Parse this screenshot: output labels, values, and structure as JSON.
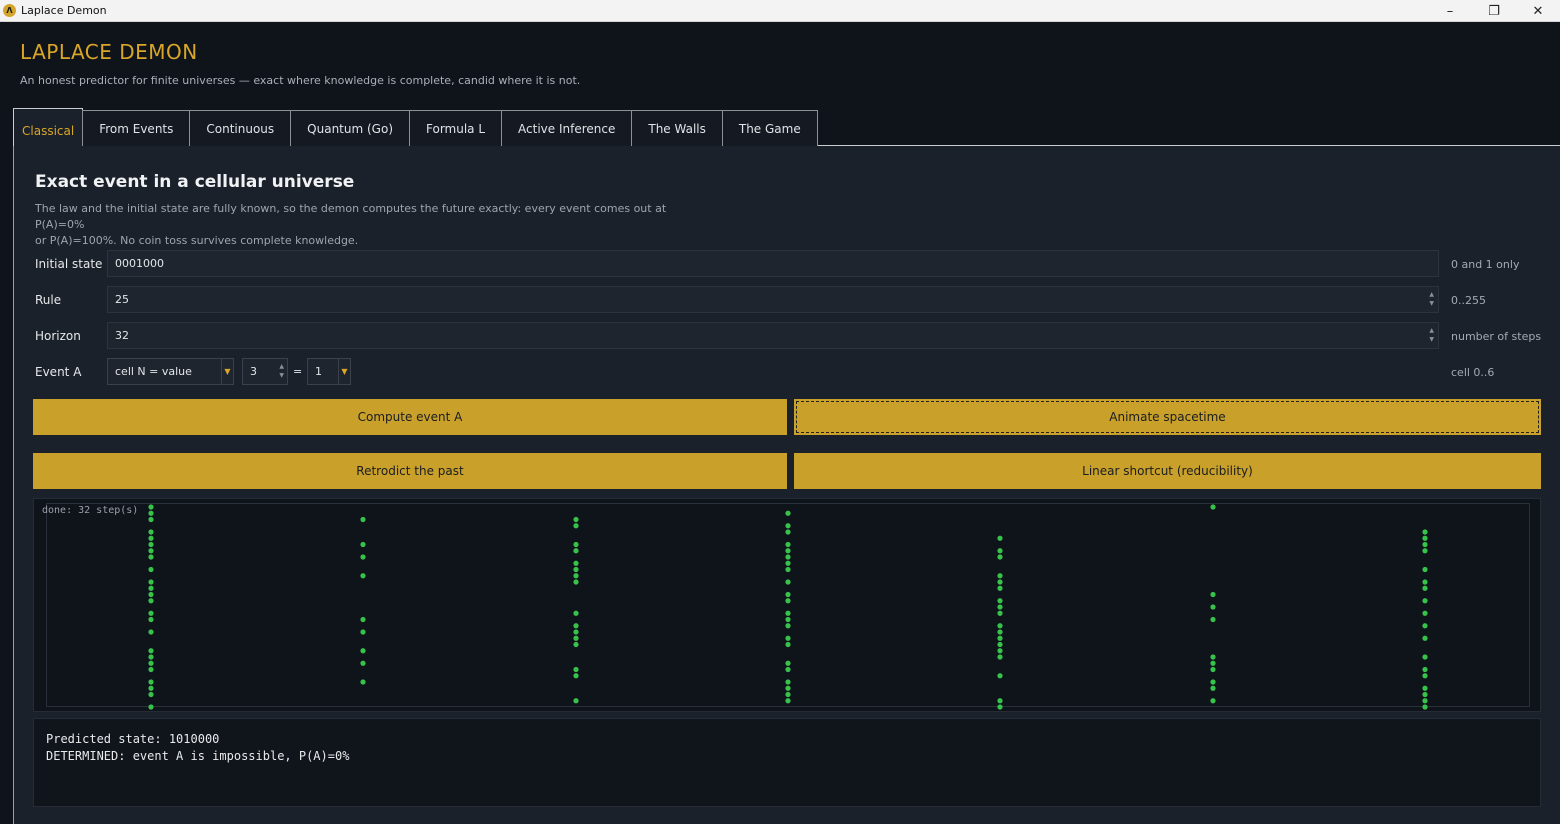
{
  "window": {
    "title": "Laplace Demon",
    "icon": "lambda-icon",
    "controls": [
      "minimize-icon",
      "restore-icon",
      "close-icon"
    ]
  },
  "app": {
    "title": "LAPLACE  DEMON",
    "subtitle": "An honest predictor for finite universes — exact where knowledge is complete, candid where it is not."
  },
  "tabs": [
    {
      "label": "Classical",
      "active": true
    },
    {
      "label": "From Events"
    },
    {
      "label": "Continuous"
    },
    {
      "label": "Quantum (Go)"
    },
    {
      "label": "Formula L"
    },
    {
      "label": "Active Inference"
    },
    {
      "label": "The Walls"
    },
    {
      "label": "The Game"
    }
  ],
  "section": {
    "title": "Exact event in a cellular universe",
    "desc_line1": "The law and the initial state are fully known, so the demon computes the future exactly: every event comes out at P(A)=0%",
    "desc_line2": "or P(A)=100%. No coin toss survives complete knowledge."
  },
  "form": {
    "initial_state": {
      "label": "Initial state",
      "value": "0001000",
      "hint": "0 and 1 only"
    },
    "rule": {
      "label": "Rule",
      "value": "25",
      "hint": "0..255"
    },
    "horizon": {
      "label": "Horizon",
      "value": "32",
      "hint": "number of steps"
    },
    "event": {
      "label": "Event A",
      "type_value": "cell N = value",
      "cell_value": "3",
      "equals": "=",
      "target_value": "1",
      "hint": "cell 0..6"
    }
  },
  "buttons": {
    "compute": "Compute event A",
    "animate": "Animate spacetime",
    "retrodict": "Retrodict the past",
    "linear": "Linear shortcut (reducibility)"
  },
  "spacetime": {
    "status": "done: 32 step(s)",
    "alive_color": "#37c24a",
    "highlight_color": "#e0443a",
    "cells": 7,
    "steps": 33,
    "grid": [
      "1000010",
      "1001000",
      "1110000",
      "0011000",
      "1001001",
      "1000101",
      "1111001",
      "1011101",
      "1101100",
      "0011000",
      "1011001",
      "0110100",
      "1011101",
      "1000101",
      "1001010",
      "1001101",
      "0000110",
      "1011101",
      "1101010",
      "0011101",
      "1110100",
      "0011101",
      "0011100",
      "1100100",
      "1000111",
      "1101010",
      "1011011",
      "0010101",
      "1101010",
      "1001011",
      "1001001",
      "0011111",
      "1000101"
    ],
    "highlight": {
      "cell": 3,
      "step": 32
    }
  },
  "output": {
    "line1": "Predicted state: 1010000",
    "line2": "DETERMINED: event A is impossible, P(A)=0%"
  }
}
